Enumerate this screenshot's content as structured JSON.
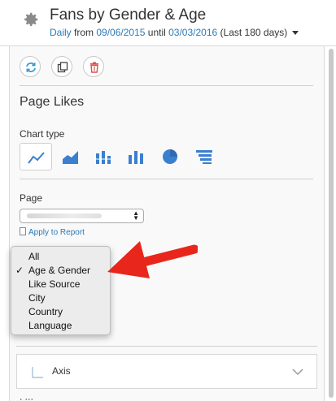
{
  "header": {
    "title": "Fans by Gender & Age",
    "period": "Daily",
    "from_label": "from",
    "start_date": "09/06/2015",
    "until_label": "until",
    "end_date": "03/03/2016",
    "range_note": "(Last 180 days)"
  },
  "toolbar": {
    "refresh_icon": "refresh-icon",
    "duplicate_icon": "duplicate-icon",
    "delete_icon": "trash-icon",
    "accent_blue": "#3a9ad9",
    "danger_red": "#d9534f"
  },
  "widget": {
    "section_title": "Page Likes",
    "chart_type_label": "Chart type",
    "chart_types": [
      "line",
      "area",
      "stacked-bar",
      "bar",
      "pie",
      "horizontal-bar"
    ],
    "selected_chart_type": "line"
  },
  "page_select": {
    "label": "Page",
    "apply_link": "Apply to Report"
  },
  "dropdown": {
    "options": [
      "All",
      "Age & Gender",
      "Like Source",
      "City",
      "Country",
      "Language"
    ],
    "selected": "Age & Gender",
    "check_mark": "✓"
  },
  "annotation": {
    "arrow_color": "#e8261b"
  },
  "axis_panel": {
    "label": "Axis",
    "expanded": false
  },
  "colors": {
    "link_blue": "#2a7ab8",
    "chart_icon_blue": "#3a7fd0"
  }
}
